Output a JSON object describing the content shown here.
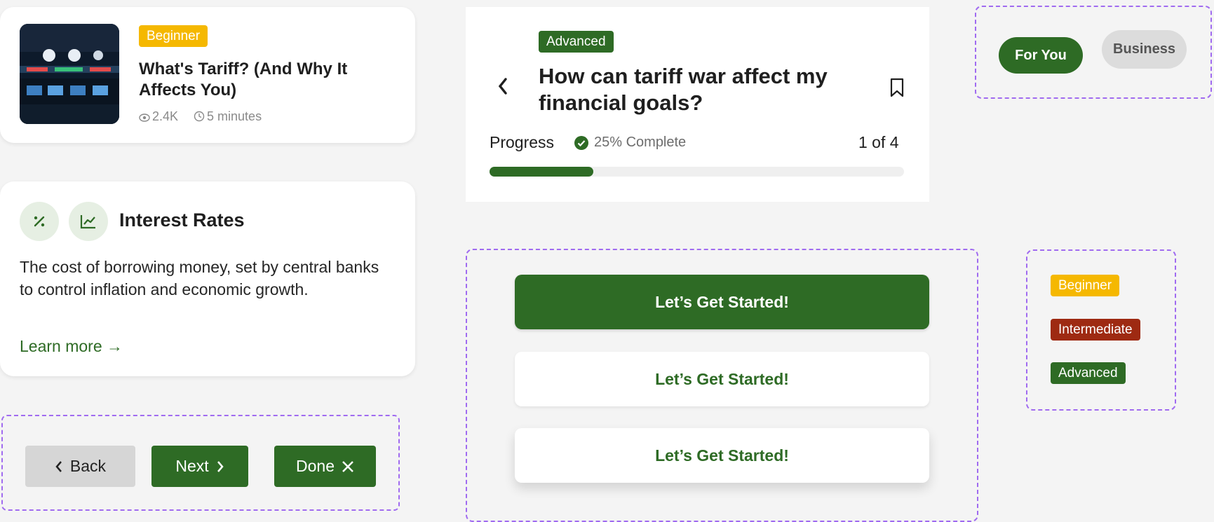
{
  "article_card": {
    "level": "Beginner",
    "title": "What's Tariff? (And Why It Affects You)",
    "views": "2.4K",
    "duration": "5 minutes"
  },
  "interest_card": {
    "title": "Interest Rates",
    "description": "The cost of borrowing money, set by central banks to control inflation and economic growth.",
    "learn_more": "Learn more →"
  },
  "nav_buttons": {
    "back": "Back",
    "next": "Next",
    "done": "Done"
  },
  "lesson": {
    "level": "Advanced",
    "title": "How can tariff war affect my financial goals?",
    "progress_label": "Progress",
    "complete_text": "25% Complete",
    "progress_fraction": 0.25,
    "step_text": "1 of 4"
  },
  "tabs": [
    {
      "label": "For You",
      "active": true
    },
    {
      "label": "Business",
      "active": false
    }
  ],
  "start_buttons": {
    "primary": "Let’s Get Started!",
    "secondary": "Let’s Get Started!",
    "tertiary": "Let’s Get Started!"
  },
  "level_badges": {
    "beginner": "Beginner",
    "intermediate": "Intermediate",
    "advanced": "Advanced"
  },
  "colors": {
    "brand_green": "#2e6b25",
    "beginner_yellow": "#f5b800",
    "intermediate_red": "#9e2a12",
    "outline_purple": "#a06bf0"
  },
  "icons": [
    "eye-icon",
    "clock-icon",
    "percent-icon",
    "line-chart-icon",
    "chevron-left-icon",
    "bookmark-icon",
    "check-circle-icon",
    "chevron-right-icon",
    "close-icon"
  ]
}
